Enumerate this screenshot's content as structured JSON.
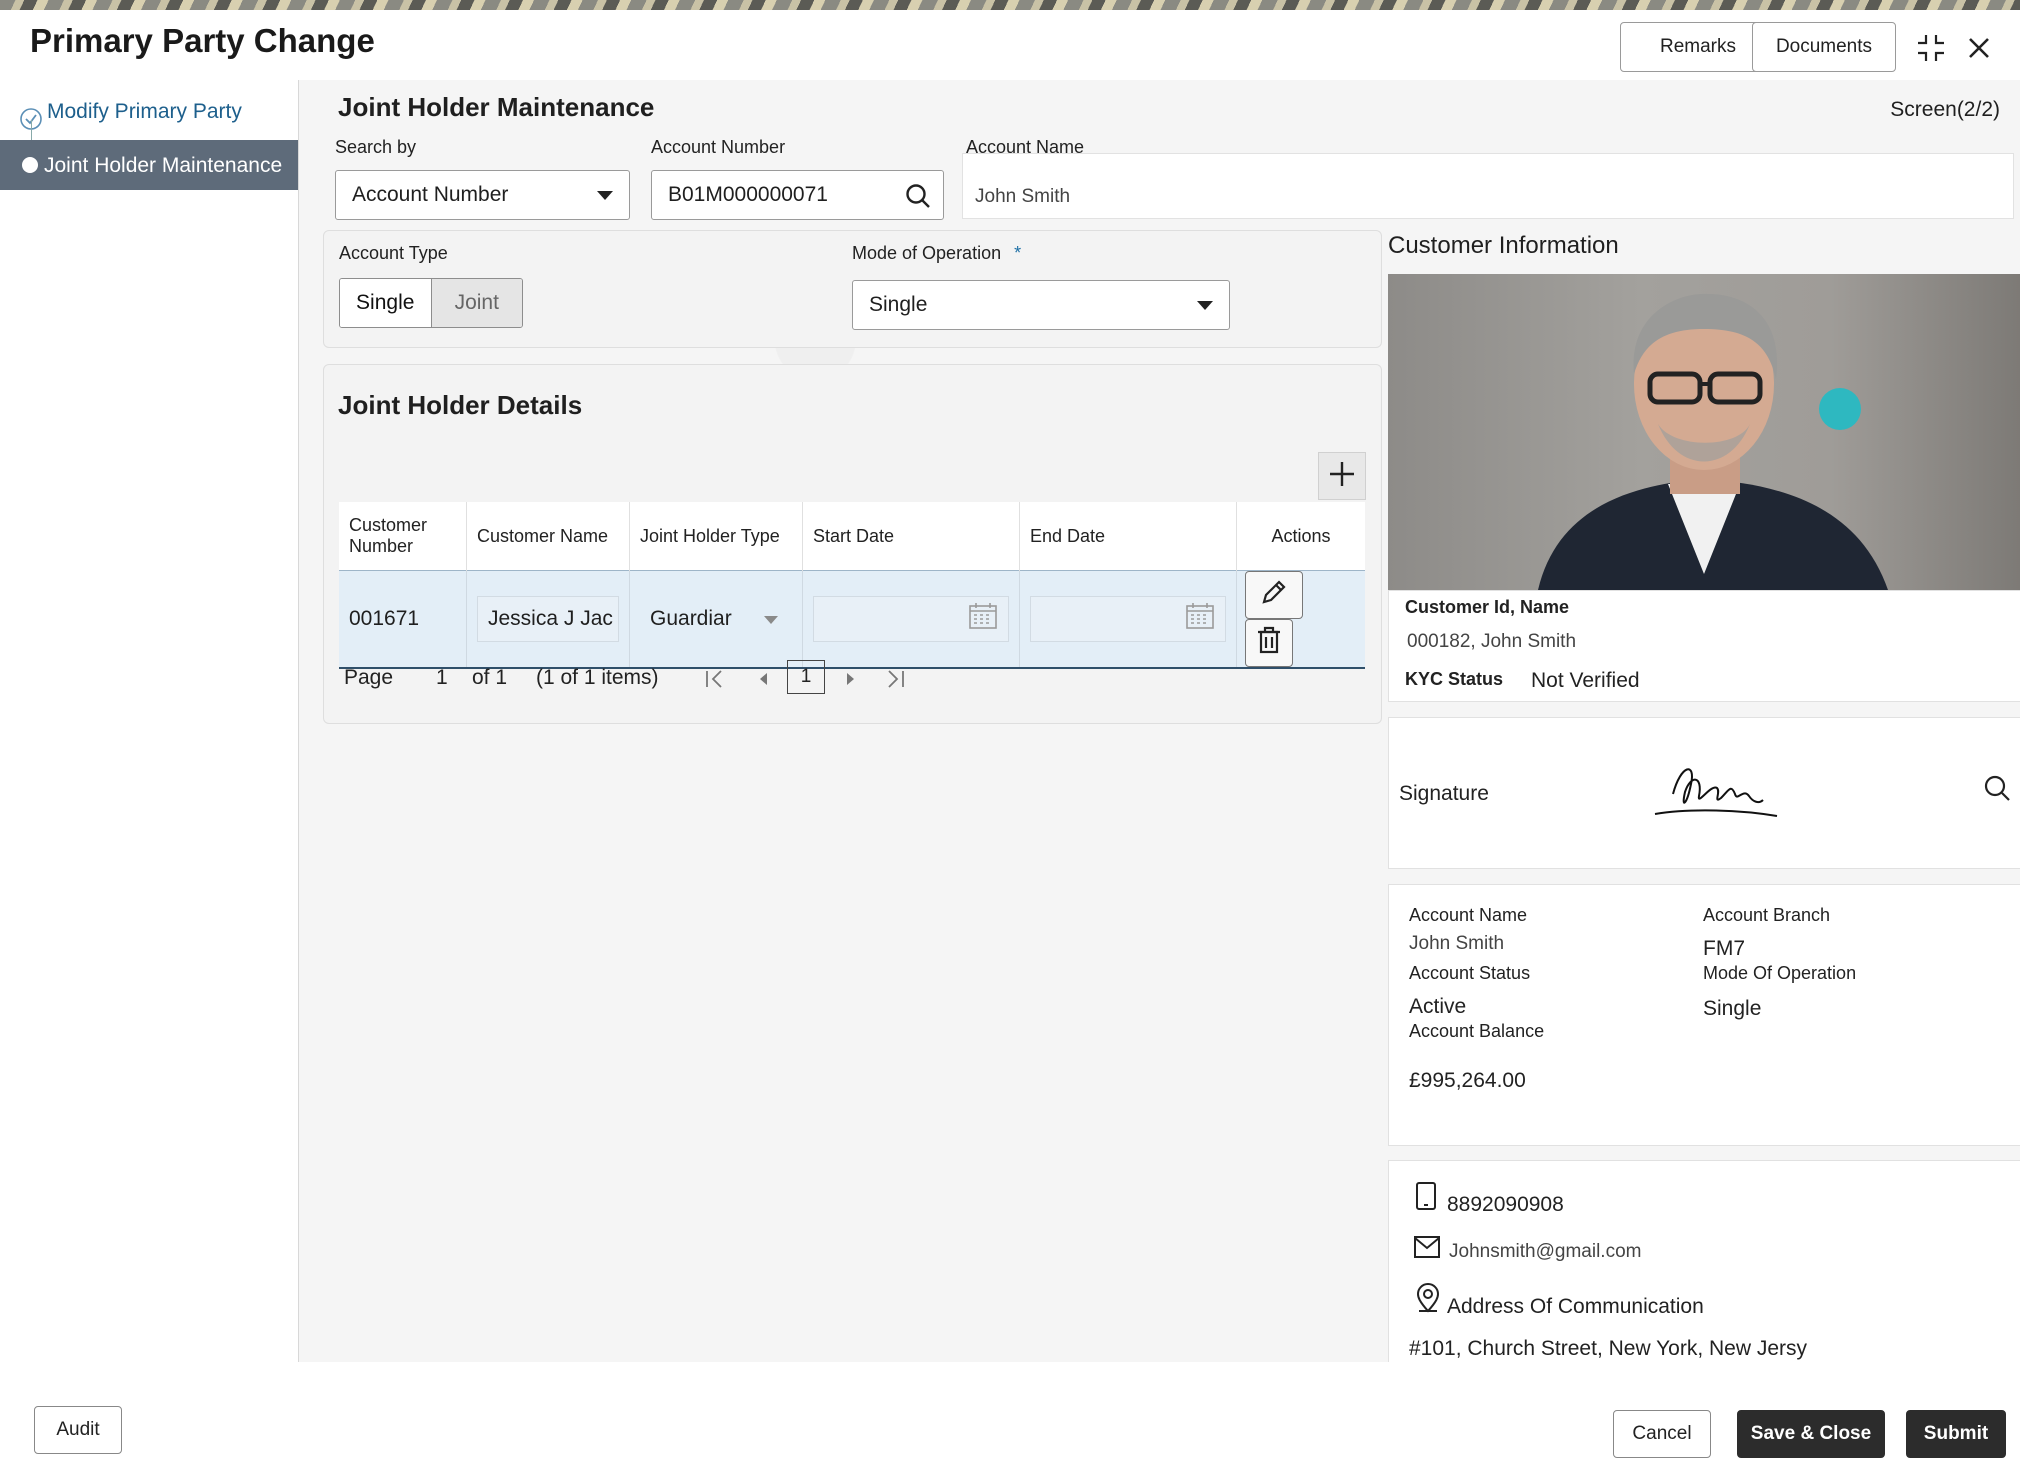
{
  "app": {
    "title": "Primary Party Change"
  },
  "header": {
    "remarks_label": "Remarks",
    "documents_label": "Documents",
    "icons": [
      "collapse-icon",
      "close-icon"
    ]
  },
  "steps": [
    {
      "label": "Modify Primary Party",
      "status": "completed"
    },
    {
      "label": "Joint Holder Maintenance",
      "status": "active"
    }
  ],
  "main": {
    "title": "Joint Holder Maintenance",
    "screen_indicator": "Screen(2/2)",
    "search_by_label": "Search by",
    "search_by_value": "Account Number",
    "account_number_label": "Account Number",
    "account_number_value": "B01M000000071",
    "account_name_label": "Account Name",
    "account_name_value": "John Smith",
    "account_type_label": "Account Type",
    "account_type_options": [
      "Single",
      "Joint"
    ],
    "account_type_selected": "Single",
    "mode_of_operation_label": "Mode of Operation",
    "required_mark": "*",
    "mode_of_operation_value": "Single"
  },
  "joint_holders": {
    "title": "Joint Holder Details",
    "columns": [
      "Customer Number",
      "Customer Name",
      "Joint Holder Type",
      "Start Date",
      "End Date",
      "Actions"
    ],
    "rows": [
      {
        "customer_number": "001671",
        "customer_name": "Jessica J Jac",
        "joint_holder_type": "Guardiar",
        "start_date": "",
        "end_date": ""
      }
    ],
    "pager": {
      "page_label": "Page",
      "page": "1",
      "of_label": "of 1",
      "items_label": "(1 of 1 items)",
      "current": "1"
    }
  },
  "customer_info": {
    "title": "Customer Information",
    "id_name_label": "Customer Id, Name",
    "id_name_value": "000182, John Smith",
    "kyc_label": "KYC Status",
    "kyc_value": "Not Verified",
    "signature_label": "Signature",
    "account_name_label": "Account Name",
    "account_name_value": "John Smith",
    "account_branch_label": "Account Branch",
    "account_branch_value": "FM7",
    "account_status_label": "Account Status",
    "account_status_value": "Active",
    "mode_label": "Mode Of Operation",
    "mode_value": "Single",
    "balance_label": "Account Balance",
    "balance_value": "£995,264.00",
    "phone": "8892090908",
    "email": "Johnsmith@gmail.com",
    "address_label": "Address Of Communication",
    "address_value": "#101, Church Street, New York, New Jersy"
  },
  "footer": {
    "audit_label": "Audit",
    "cancel_label": "Cancel",
    "save_close_label": "Save & Close",
    "submit_label": "Submit"
  }
}
